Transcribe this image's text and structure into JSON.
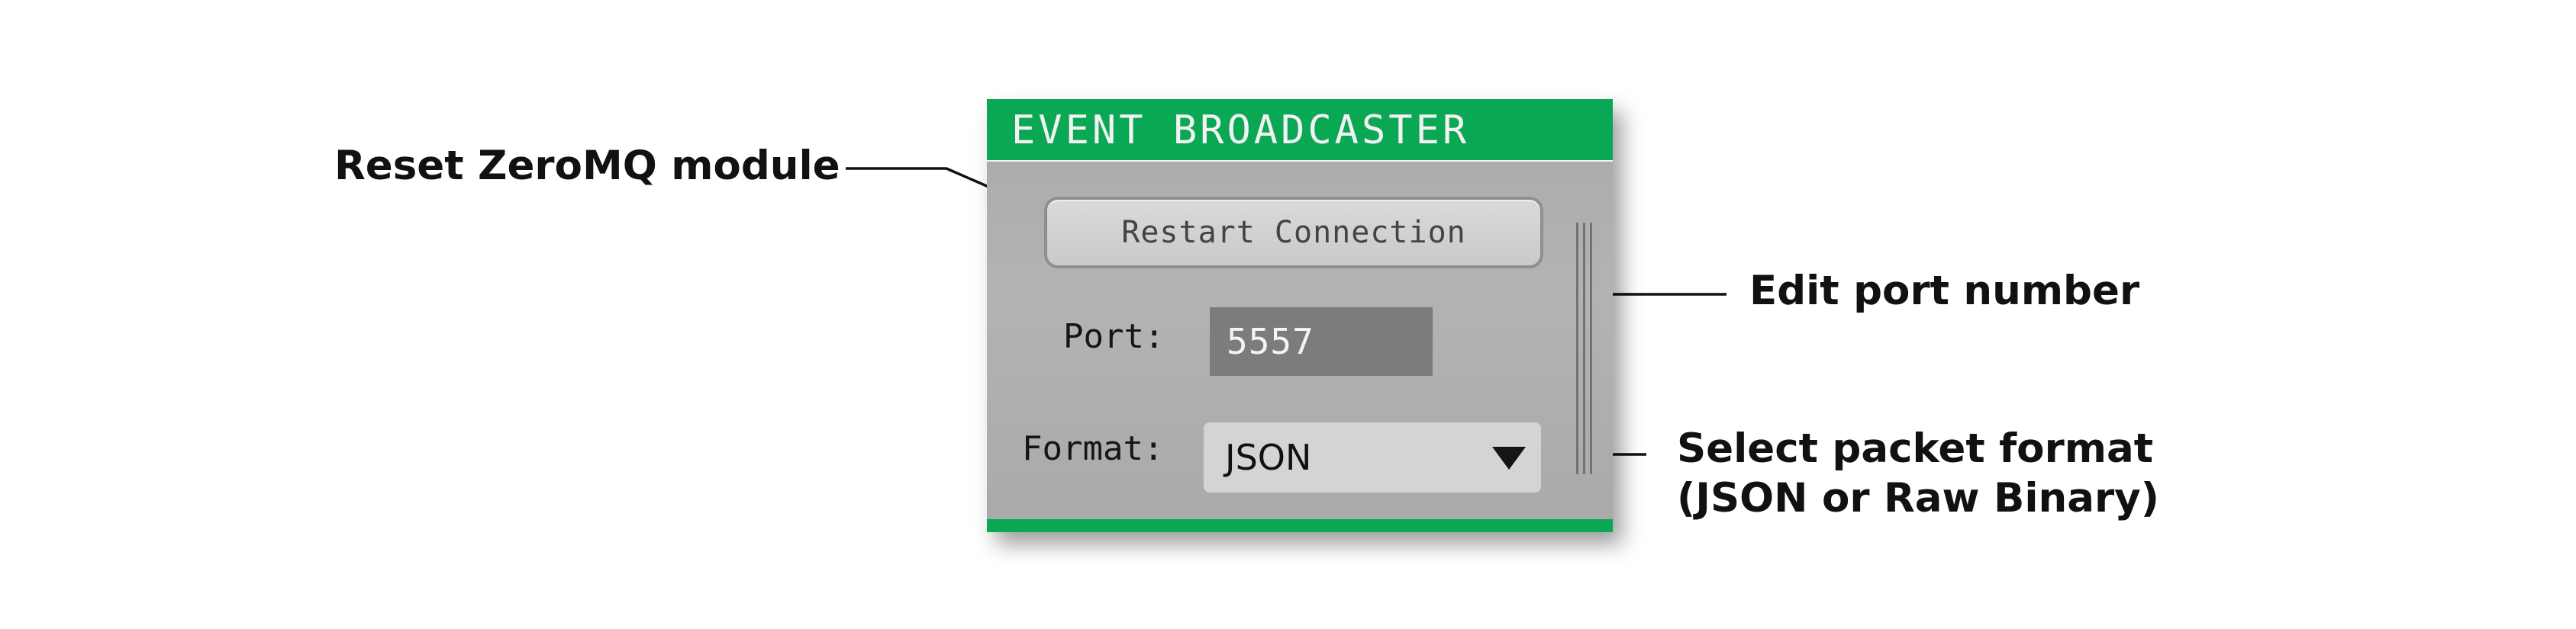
{
  "annotations": {
    "reset": "Reset ZeroMQ module",
    "port": "Edit port number",
    "format_line1": "Select packet format",
    "format_line2": "(JSON or Raw Binary)"
  },
  "panel": {
    "title": "EVENT BROADCASTER",
    "restart_label": "Restart Connection",
    "port_label": "Port:",
    "port_value": "5557",
    "format_label": "Format:",
    "format_value": "JSON",
    "dropdown_icon": "triangle-down"
  },
  "colors": {
    "accent_green": "#0aa755",
    "panel_gray": "#adadad",
    "input_dark": "#7c7c7c",
    "select_light": "#d4d4d4"
  }
}
